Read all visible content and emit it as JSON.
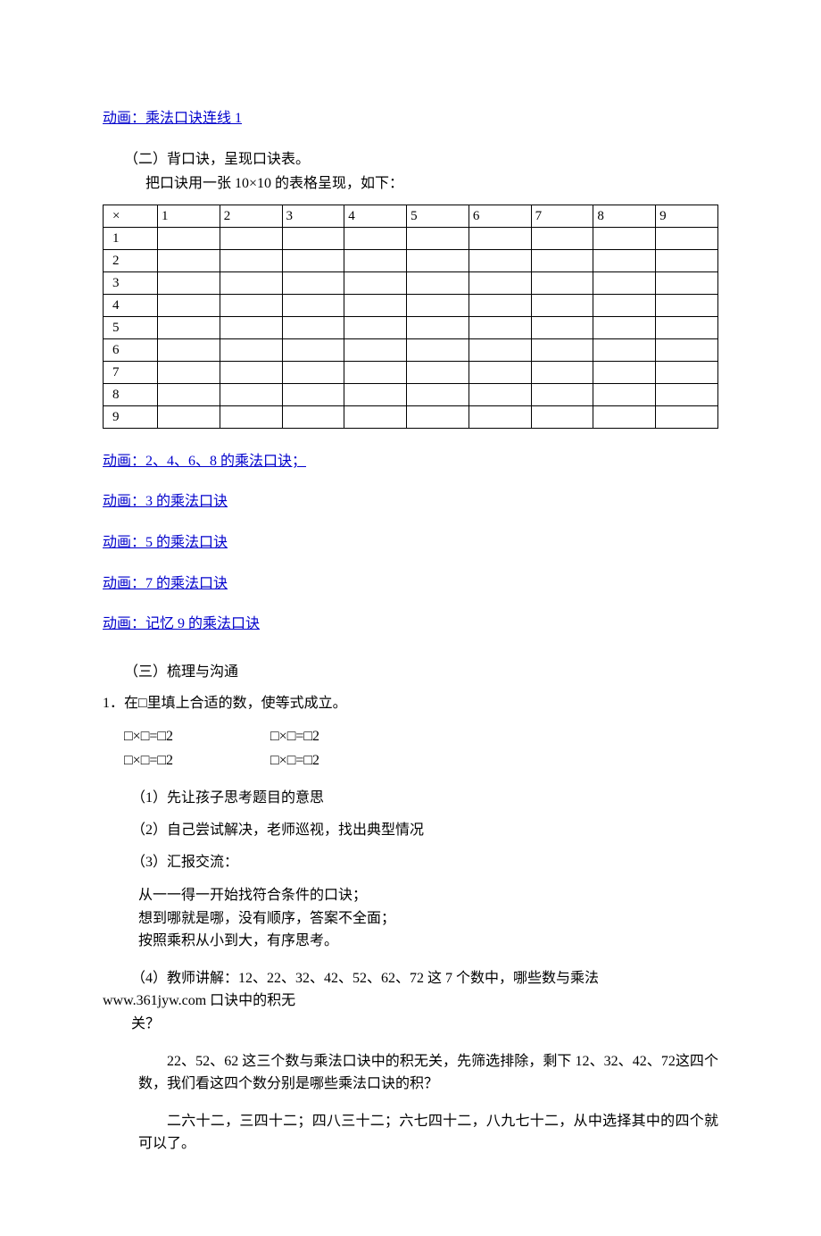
{
  "links": {
    "top": "动画：乘法口诀连线 1",
    "l2468": "动画：2、4、6、8 的乘法口诀；",
    "l3": "动画：3 的乘法口诀",
    "l5": "动画：5 的乘法口诀",
    "l7": "动画：7 的乘法口诀",
    "l9": "动画：记忆 9 的乘法口诀"
  },
  "sec2": {
    "title": "（二）背口诀，呈现口诀表。",
    "desc": "把口诀用一张 10×10 的表格呈现，如下：",
    "table": {
      "corner": "×",
      "cols": [
        "1",
        "2",
        "3",
        "4",
        "5",
        "6",
        "7",
        "8",
        "9"
      ],
      "rows": [
        "1",
        "2",
        "3",
        "4",
        "5",
        "6",
        "7",
        "8",
        "9"
      ]
    }
  },
  "sec3": {
    "title": "（三）梳理与沟通",
    "q1": "1．在□里填上合适的数，使等式成立。",
    "eq1": "□×□=□2",
    "eq2": "□×□=□2",
    "eq3": "□×□=□2",
    "eq4": "□×□=□2",
    "step1": "（1）先让孩子思考题目的意思",
    "step2": "（2）自己尝试解决，老师巡视，找出典型情况",
    "step3": "（3）汇报交流：",
    "note1": "从一一得一开始找符合条件的口诀；",
    "note2": "想到哪就是哪，没有顺序，答案不全面；",
    "note3": "按照乘积从小到大，有序思考。",
    "step4a": "（4）教师讲解：12、22、32、42、52、62、72 这 7 个数中，哪些数与乘法",
    "step4url": "www.361jyw.com 口诀中的积无",
    "step4b": "关？",
    "ans1": "22、52、62 这三个数与乘法口诀中的积无关，先筛选排除，剩下 12、32、42、72这四个数，我们看这四个数分别是哪些乘法口诀的积？",
    "ans2": "二六十二，三四十二；四八三十二；六七四十二，八九七十二，从中选择其中的四个就可以了。"
  }
}
